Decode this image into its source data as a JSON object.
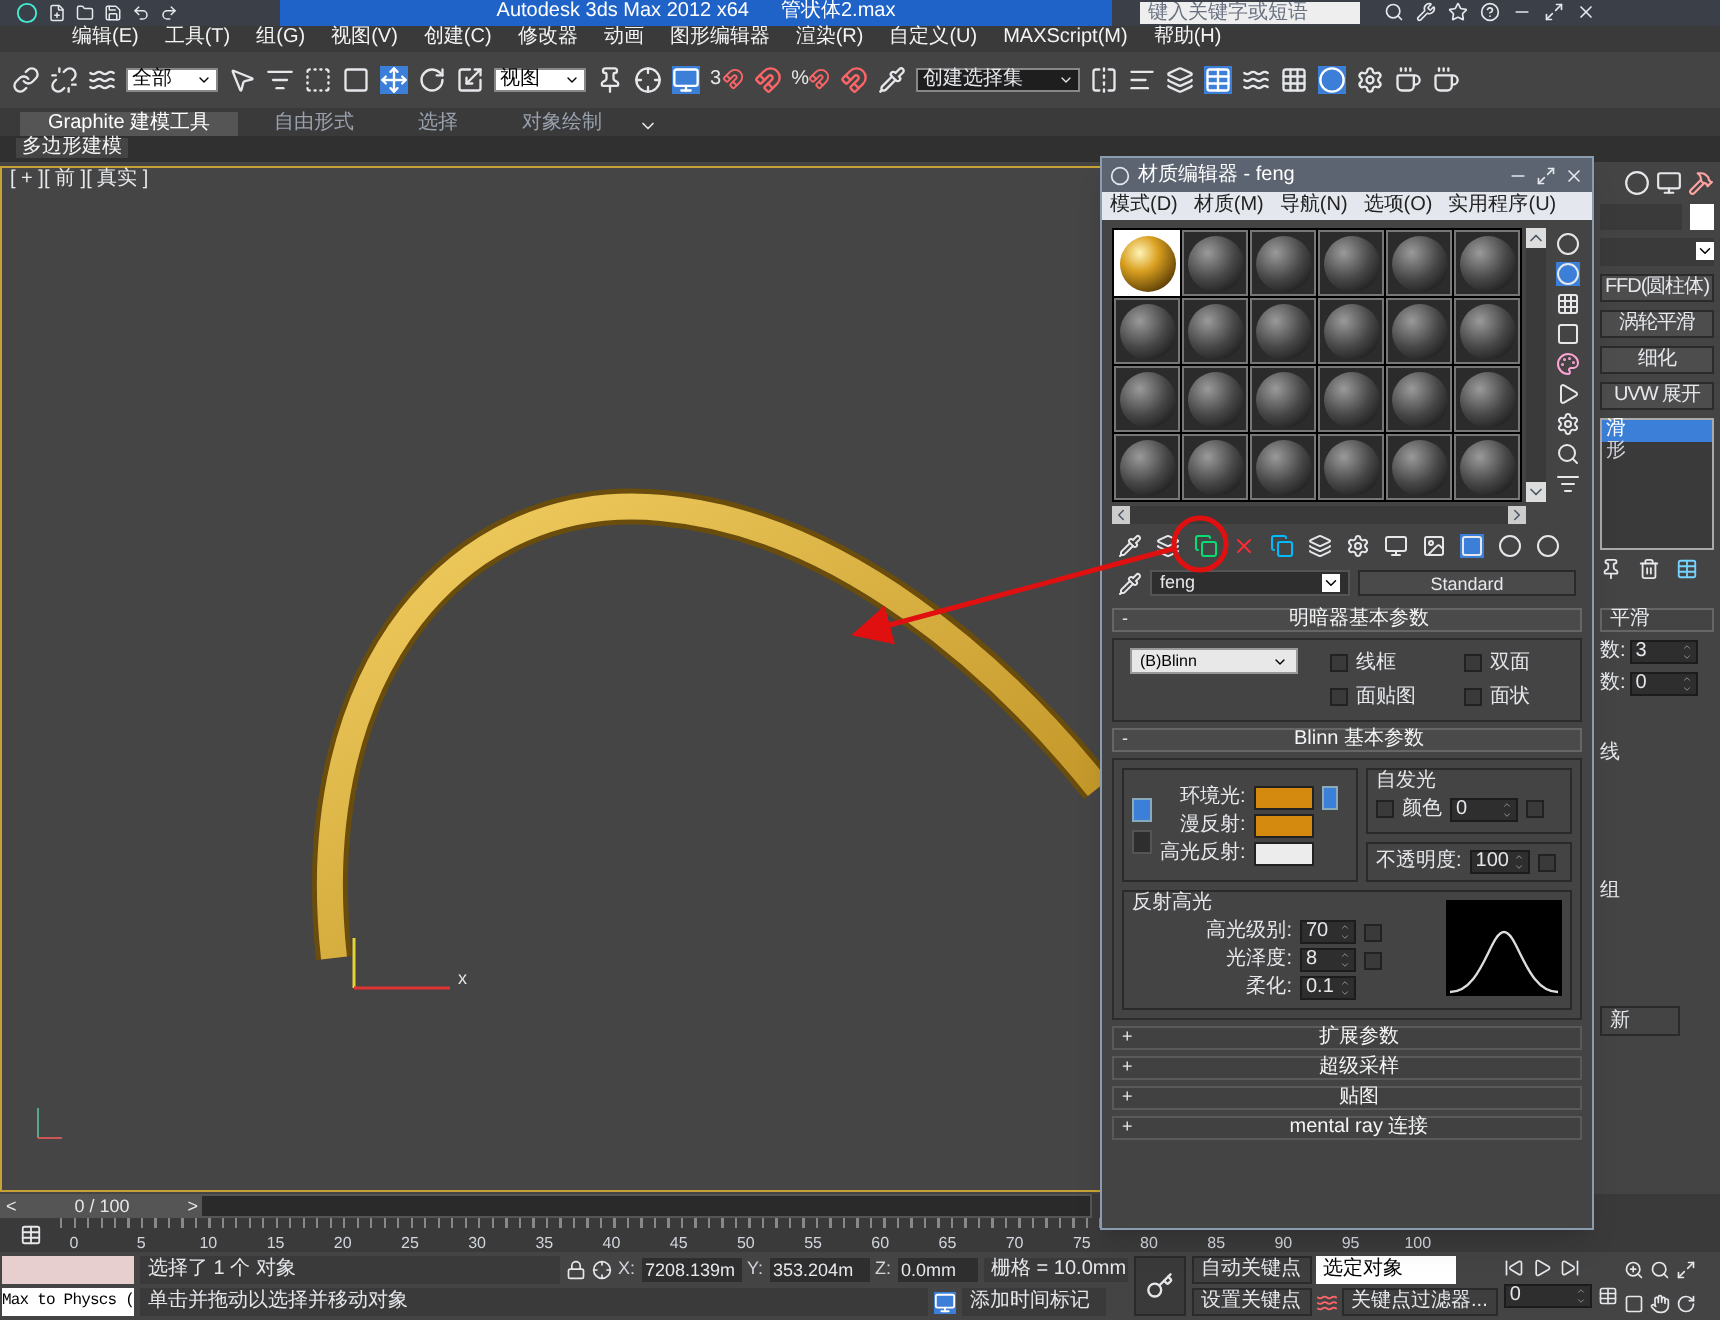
{
  "window": {
    "title": "Autodesk 3ds Max  2012 x64",
    "file": "管状体2.max",
    "search": {
      "placeholder": "键入关键字或短语"
    }
  },
  "menu": [
    "编辑(E)",
    "工具(T)",
    "组(G)",
    "视图(V)",
    "创建(C)",
    "修改器",
    "动画",
    "图形编辑器",
    "渲染(R)",
    "自定义(U)",
    "MAXScript(M)",
    "帮助(H)"
  ],
  "toolbar": {
    "selection_filter": "全部",
    "reference_coord": "视图",
    "snap_angle": "3",
    "snap_percent": "%",
    "named_selection": "创建选择集"
  },
  "ribbon": {
    "tabs": [
      {
        "label": "Graphite 建模工具",
        "selected": true
      },
      {
        "label": "自由形式",
        "selected": false
      },
      {
        "label": "选择",
        "selected": false
      },
      {
        "label": "对象绘制",
        "selected": false
      }
    ],
    "panel": "多边形建模"
  },
  "viewport": {
    "label": "[ + ][ 前 ][ 真实 ]",
    "axis_label": "x"
  },
  "material_editor": {
    "title": "材质编辑器 - feng",
    "menu": [
      "模式(D)",
      "材质(M)",
      "导航(N)",
      "选项(O)",
      "实用程序(U)"
    ],
    "slots": [
      {
        "kind": "gold",
        "selected": true
      },
      {
        "kind": "default",
        "selected": false
      },
      {
        "kind": "default",
        "selected": false
      },
      {
        "kind": "default",
        "selected": false
      },
      {
        "kind": "default",
        "selected": false
      },
      {
        "kind": "default",
        "selected": false
      },
      {
        "kind": "default",
        "selected": false
      },
      {
        "kind": "default",
        "selected": false
      },
      {
        "kind": "default",
        "selected": false
      },
      {
        "kind": "default",
        "selected": false
      },
      {
        "kind": "default",
        "selected": false
      },
      {
        "kind": "default",
        "selected": false
      },
      {
        "kind": "default",
        "selected": false
      },
      {
        "kind": "default",
        "selected": false
      },
      {
        "kind": "default",
        "selected": false
      },
      {
        "kind": "default",
        "selected": false
      },
      {
        "kind": "default",
        "selected": false
      },
      {
        "kind": "default",
        "selected": false
      },
      {
        "kind": "default",
        "selected": false
      },
      {
        "kind": "default",
        "selected": false
      },
      {
        "kind": "default",
        "selected": false
      },
      {
        "kind": "default",
        "selected": false
      },
      {
        "kind": "default",
        "selected": false
      },
      {
        "kind": "default",
        "selected": false
      }
    ],
    "material_name": "feng",
    "material_type": "Standard",
    "rollouts": [
      {
        "kind": "shader",
        "toggle": "-",
        "title": "明暗器基本参数",
        "expanded": true,
        "shader": "(B)Blinn",
        "options": [
          {
            "label": "线框",
            "checked": false
          },
          {
            "label": "双面",
            "checked": false
          },
          {
            "label": "面贴图",
            "checked": false
          },
          {
            "label": "面状",
            "checked": false
          }
        ]
      },
      {
        "kind": "blinn",
        "toggle": "-",
        "title": "Blinn 基本参数",
        "expanded": true,
        "colors": [
          {
            "label": "环境光:",
            "color": "#d4890f"
          },
          {
            "label": "漫反射:",
            "color": "#d4890f"
          },
          {
            "label": "高光反射:",
            "color": "#ececec"
          }
        ],
        "self_illum": {
          "title": "自发光",
          "label": "颜色",
          "checked": false,
          "value": "0"
        },
        "opacity": {
          "label": "不透明度:",
          "value": "100"
        },
        "highlights": {
          "title": "反射高光",
          "params": [
            {
              "label": "高光级别:",
              "value": "70"
            },
            {
              "label": "光泽度:",
              "value": "8"
            },
            {
              "label": "柔化:",
              "value": "0.1"
            }
          ]
        }
      },
      {
        "kind": "collapsed",
        "toggle": "+",
        "title": "扩展参数",
        "expanded": false
      },
      {
        "kind": "collapsed",
        "toggle": "+",
        "title": "超级采样",
        "expanded": false
      },
      {
        "kind": "collapsed",
        "toggle": "+",
        "title": "贴图",
        "expanded": false
      },
      {
        "kind": "collapsed",
        "toggle": "+",
        "title": "mental ray 连接",
        "expanded": false
      }
    ]
  },
  "command_panel": {
    "modifiers": [
      "FFD(圆柱体)",
      "涡轮平滑",
      "细化",
      "UVW 展开"
    ],
    "stack": [
      {
        "label": "滑",
        "selected": true
      },
      {
        "label": "形",
        "selected": false
      }
    ],
    "rollout": "平滑",
    "params": [
      {
        "label": "数:",
        "value": "3"
      },
      {
        "label": "数:",
        "value": "0"
      }
    ],
    "labels": [
      "线",
      "组"
    ],
    "button": "新"
  },
  "timeline": {
    "position": "0 / 100",
    "prev": "<",
    "next": ">",
    "level": 0,
    "ticks": [
      "0",
      "5",
      "10",
      "15",
      "20",
      "25",
      "30",
      "35",
      "40",
      "45",
      "50",
      "55",
      "60",
      "65",
      "70",
      "75",
      "80",
      "85",
      "90",
      "95",
      "100"
    ]
  },
  "status_bar": {
    "listener": "Max to Physcs (",
    "selection": "选择了 1 个 对象",
    "prompt": "单击并拖动以选择并移动对象",
    "coords": [
      {
        "label": "X:",
        "value": "7208.139m"
      },
      {
        "label": "Y:",
        "value": "353.204m"
      },
      {
        "label": "Z:",
        "value": "0.0mm"
      }
    ],
    "grid": "栅格 = 10.0mm",
    "add_time_tag": "添加时间标记",
    "auto_key": "自动关键点",
    "key_mode": "选定对象",
    "set_key": "设置关键点",
    "key_filters": "关键点过滤器...",
    "frame": "0"
  }
}
